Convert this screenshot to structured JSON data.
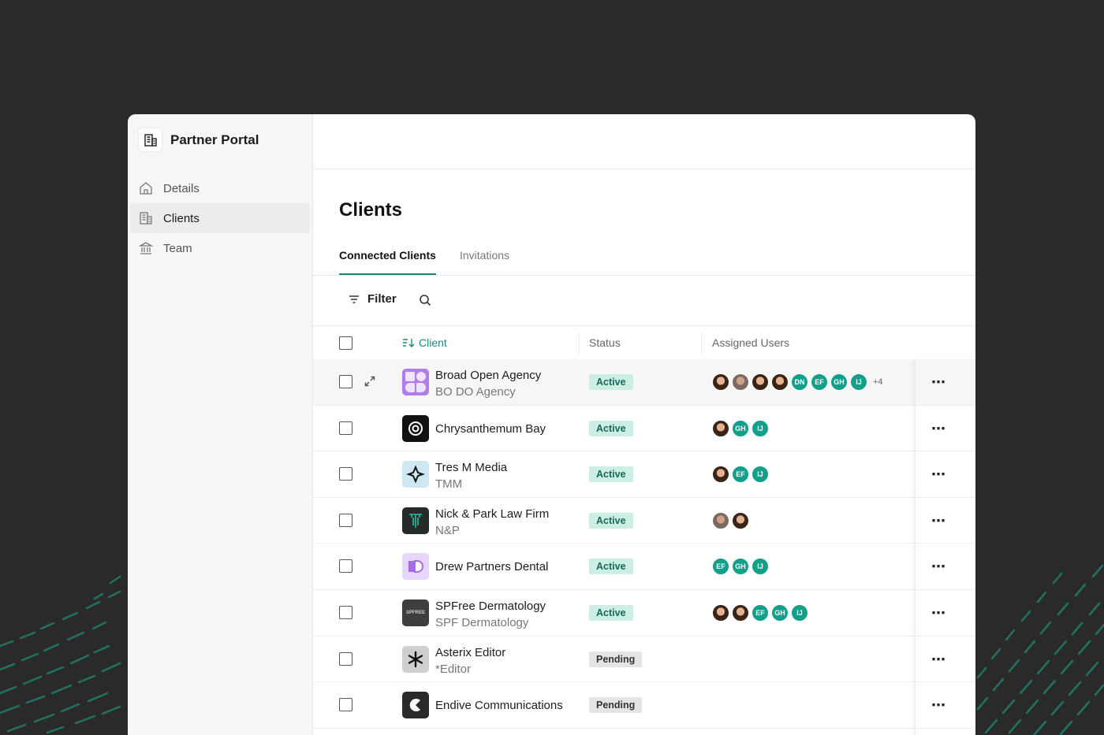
{
  "app": {
    "title": "Partner Portal"
  },
  "sidebar": {
    "items": [
      {
        "label": "Details",
        "icon": "home-icon"
      },
      {
        "label": "Clients",
        "icon": "building-icon",
        "active": true
      },
      {
        "label": "Team",
        "icon": "bank-icon"
      }
    ]
  },
  "page": {
    "title": "Clients"
  },
  "tabs": [
    {
      "label": "Connected Clients",
      "active": true
    },
    {
      "label": "Invitations",
      "active": false
    }
  ],
  "toolbar": {
    "filter_label": "Filter"
  },
  "table": {
    "columns": {
      "client": "Client",
      "status": "Status",
      "assigned": "Assigned Users"
    },
    "rows": [
      {
        "name": "Broad Open Agency",
        "sub": "BO DO Agency",
        "status": "Active",
        "users": [
          "photo",
          "photo2",
          "photo",
          "photo"
        ],
        "initials": [
          "DN",
          "EF",
          "GH",
          "IJ"
        ],
        "more": "+4",
        "logo": "bodo"
      },
      {
        "name": "Chrysanthemum Bay",
        "sub": "",
        "status": "Active",
        "users": [
          "photo"
        ],
        "initials": [
          "GH",
          "IJ"
        ],
        "more": "",
        "logo": "chrys"
      },
      {
        "name": "Tres M Media",
        "sub": "TMM",
        "status": "Active",
        "users": [
          "photo"
        ],
        "initials": [
          "EF",
          "IJ"
        ],
        "more": "",
        "logo": "tmm"
      },
      {
        "name": "Nick & Park Law Firm",
        "sub": "N&P",
        "status": "Active",
        "users": [
          "photo2",
          "photo"
        ],
        "initials": [],
        "more": "",
        "logo": "np"
      },
      {
        "name": "Drew Partners Dental",
        "sub": "",
        "status": "Active",
        "users": [],
        "initials": [
          "EF",
          "GH",
          "IJ"
        ],
        "more": "",
        "logo": "dpd"
      },
      {
        "name": "SPFree Dermatology",
        "sub": "SPF Dermatology",
        "status": "Active",
        "users": [
          "photo",
          "photo"
        ],
        "initials": [
          "EF",
          "GH",
          "IJ"
        ],
        "more": "",
        "logo": "spf"
      },
      {
        "name": "Asterix Editor",
        "sub": "*Editor",
        "status": "Pending",
        "users": [],
        "initials": [],
        "more": "",
        "logo": "ast"
      },
      {
        "name": "Endive Communications",
        "sub": "",
        "status": "Pending",
        "users": [],
        "initials": [],
        "more": "",
        "logo": "end"
      }
    ]
  },
  "logos": {
    "spf_text": "SPFREE"
  },
  "colors": {
    "accent": "#1a8a78",
    "active_bg": "#cdeee5",
    "pending_bg": "#e4e4e4",
    "avatar_initials": "#12a08a",
    "background": "#2b2a2b"
  }
}
